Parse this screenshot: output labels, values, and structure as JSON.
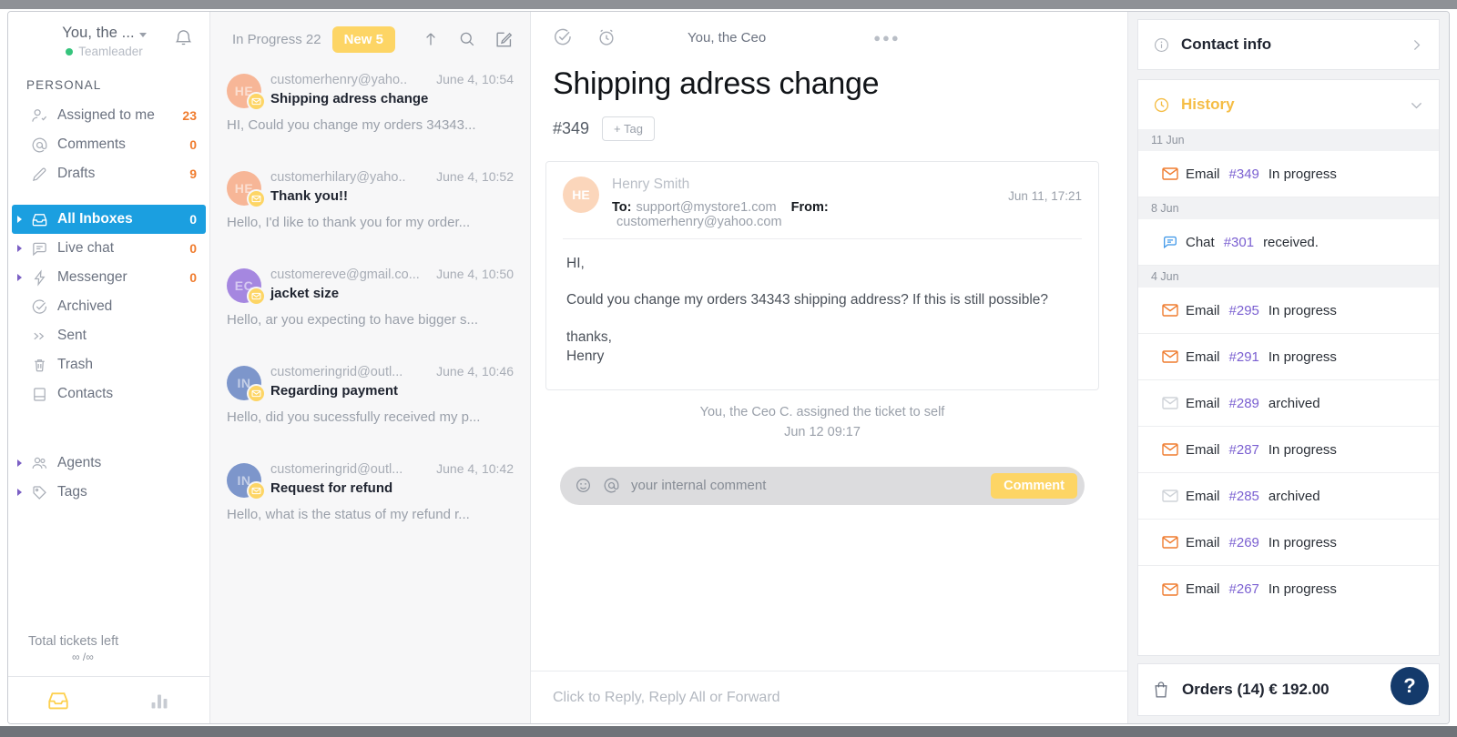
{
  "sidebar": {
    "user_name": "You, the ...",
    "user_role": "Teamleader",
    "section_label": "PERSONAL",
    "personal": [
      {
        "label": "Assigned to me",
        "count": "23",
        "icon": "user-check-icon"
      },
      {
        "label": "Comments",
        "count": "0",
        "icon": "at-icon"
      },
      {
        "label": "Drafts",
        "count": "9",
        "icon": "pencil-icon"
      }
    ],
    "inboxes": [
      {
        "label": "All Inboxes",
        "count": "0",
        "icon": "inbox-icon",
        "active": true,
        "caret": true
      },
      {
        "label": "Live chat",
        "count": "0",
        "icon": "chat-icon",
        "active": false,
        "caret": true
      },
      {
        "label": "Messenger",
        "count": "0",
        "icon": "bolt-icon",
        "active": false,
        "caret": true
      },
      {
        "label": "Archived",
        "count": "",
        "icon": "check-circle-icon",
        "active": false,
        "caret": false
      },
      {
        "label": "Sent",
        "count": "",
        "icon": "double-chevron-right-icon",
        "active": false,
        "caret": false
      },
      {
        "label": "Trash",
        "count": "",
        "icon": "trash-icon",
        "active": false,
        "caret": false
      },
      {
        "label": "Contacts",
        "count": "",
        "icon": "contacts-icon",
        "active": false,
        "caret": false
      }
    ],
    "manage": [
      {
        "label": "Agents",
        "count": "",
        "icon": "agents-icon",
        "caret": true
      },
      {
        "label": "Tags",
        "count": "",
        "icon": "tag-icon",
        "caret": true
      }
    ],
    "total_label": "Total tickets left",
    "total_value": "∞ /∞"
  },
  "list": {
    "filter_in_progress": "In Progress 22",
    "filter_new": "New 5",
    "tickets": [
      {
        "initials": "HE",
        "avatar_color": "#f7b697",
        "from": "customerhenry@yaho..",
        "time": "June 4, 10:54",
        "subject": "Shipping adress change",
        "preview": "HI, Could you change my orders 34343..."
      },
      {
        "initials": "HE",
        "avatar_color": "#f7b697",
        "from": "customerhilary@yaho..",
        "time": "June 4, 10:52",
        "subject": "Thank you!!",
        "preview": "Hello, I'd like to thank you for  my order..."
      },
      {
        "initials": "EC",
        "avatar_color": "#a587e0",
        "from": "customereve@gmail.co...",
        "time": "June 4, 10:50",
        "subject": "jacket size",
        "preview": "Hello, ar you expecting to have bigger s..."
      },
      {
        "initials": "IN",
        "avatar_color": "#7d96cb",
        "from": "customeringrid@outl...",
        "time": "June 4, 10:46",
        "subject": "Regarding payment",
        "preview": "Hello, did you sucessfully received my p..."
      },
      {
        "initials": "IN",
        "avatar_color": "#7d96cb",
        "from": "customeringrid@outl...",
        "time": "June 4, 10:42",
        "subject": "Request for refund",
        "preview": "Hello, what is the status of my refund r..."
      }
    ]
  },
  "conversation": {
    "assignee": "You, the Ceo",
    "more_dots": "●●●",
    "title": "Shipping adress change",
    "ticket_id": "#349",
    "tag_button": "+ Tag",
    "message": {
      "initials": "HE",
      "sender": "Henry Smith",
      "to_label": "To:",
      "to_value": "support@mystore1.com",
      "from_label": "From:",
      "from_value": "customerhenry@yahoo.com",
      "date": "Jun 11, 17:21",
      "greeting": "HI,",
      "body": "Could you change my orders 34343 shipping address? If this is still possible?",
      "sign_off": "thanks,",
      "signature": "Henry"
    },
    "system_note": "You, the Ceo C. assigned the ticket to self",
    "system_note_date": "Jun 12 09:17",
    "comment_placeholder": "your internal comment",
    "comment_button": "Comment",
    "reply_placeholder": "Click to Reply, Reply All or Forward"
  },
  "right_panel": {
    "contact_info_title": "Contact info",
    "history_title": "History",
    "history": [
      {
        "day": "11 Jun",
        "rows": [
          {
            "type": "Email",
            "number": "#349",
            "status": "In progress",
            "icon": "envelope-icon",
            "icon_color": "#ef7c2f"
          }
        ]
      },
      {
        "day": "8 Jun",
        "rows": [
          {
            "type": "Chat",
            "number": "#301",
            "status": "received.",
            "icon": "chat-icon",
            "icon_color": "#3b95e8"
          }
        ]
      },
      {
        "day": "4 Jun",
        "rows": [
          {
            "type": "Email",
            "number": "#295",
            "status": "In progress",
            "icon": "envelope-icon",
            "icon_color": "#ef7c2f"
          },
          {
            "type": "Email",
            "number": "#291",
            "status": "In progress",
            "icon": "envelope-icon",
            "icon_color": "#ef7c2f"
          },
          {
            "type": "Email",
            "number": "#289",
            "status": "archived",
            "icon": "envelope-icon",
            "icon_color": "#cfd3d8"
          },
          {
            "type": "Email",
            "number": "#287",
            "status": "In progress",
            "icon": "envelope-icon",
            "icon_color": "#ef7c2f"
          },
          {
            "type": "Email",
            "number": "#285",
            "status": "archived",
            "icon": "envelope-icon",
            "icon_color": "#cfd3d8"
          },
          {
            "type": "Email",
            "number": "#269",
            "status": "In progress",
            "icon": "envelope-icon",
            "icon_color": "#ef7c2f"
          },
          {
            "type": "Email",
            "number": "#267",
            "status": "In progress",
            "icon": "envelope-icon",
            "icon_color": "#ef7c2f"
          }
        ]
      }
    ],
    "orders_label": "Orders (14) € 192.00",
    "help_label": "?"
  },
  "colors": {
    "accent_blue": "#1b9fe0",
    "accent_yellow": "#fdd565",
    "count_orange": "#f07c2e",
    "link_purple": "#7a5fd1",
    "help_navy": "#143a6b"
  }
}
